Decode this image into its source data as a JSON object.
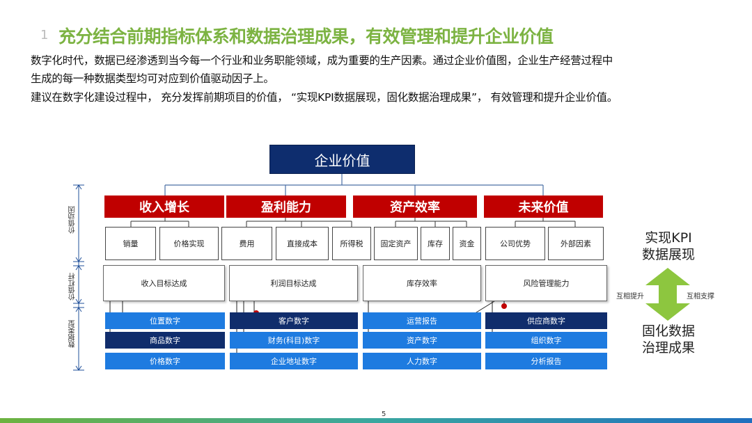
{
  "header": {
    "number": "1",
    "title": "充分结合前期指标体系和数据治理成果，有效管理和提升企业价值"
  },
  "intro": {
    "line1": "数字化时代，数据已经渗透到当今每一个行业和业务职能领域，成为重要的生产因素。通过企业价值图，企业生产经营过程中",
    "line2": "生成的每一种数据类型均可对应到价值驱动因子上。",
    "line3": "建议在数字化建设过程中，  充分发挥前期项目的价值，  “实现KPI数据展现，固化数据治理成果”，  有效管理和提升企业价值。"
  },
  "diagram": {
    "top": "企业价值",
    "categories": [
      "收入增长",
      "盈利能力",
      "资产效率",
      "未来价值"
    ],
    "drivers": [
      "销量",
      "价格实现",
      "费用",
      "直接成本",
      "所得税",
      "固定资产",
      "库存",
      "资金",
      "公司优势",
      "外部因素"
    ],
    "levers": [
      "收入目标达成",
      "利润目标达成",
      "库存效率",
      "风险管理能力"
    ],
    "data_types": {
      "col1": [
        "位置数字",
        "商品数字",
        "价格数字"
      ],
      "col2": [
        "客户数字",
        "财务(科目)数字",
        "企业地址数字"
      ],
      "col3": [
        "运营报告",
        "资产数字",
        "人力数字"
      ],
      "col4": [
        "供应商数字",
        "组织数字",
        "分析报告"
      ]
    },
    "side_labels": {
      "drivers": "价值动因",
      "levers": "价值杠杆",
      "data_types": "数据类型"
    },
    "right": {
      "top_line1": "实现KPI",
      "top_line2": "数据展现",
      "bottom_line1": "固化数据",
      "bottom_line2": "治理成果",
      "left_label": "互相提升",
      "right_label": "互相支撑"
    }
  },
  "footer": {
    "page": "5"
  },
  "colors": {
    "title_green": "#7cb342",
    "navy": "#0e2d6e",
    "red": "#c00000",
    "blue": "#1e7be0",
    "arrow_green": "#8dc63f"
  }
}
